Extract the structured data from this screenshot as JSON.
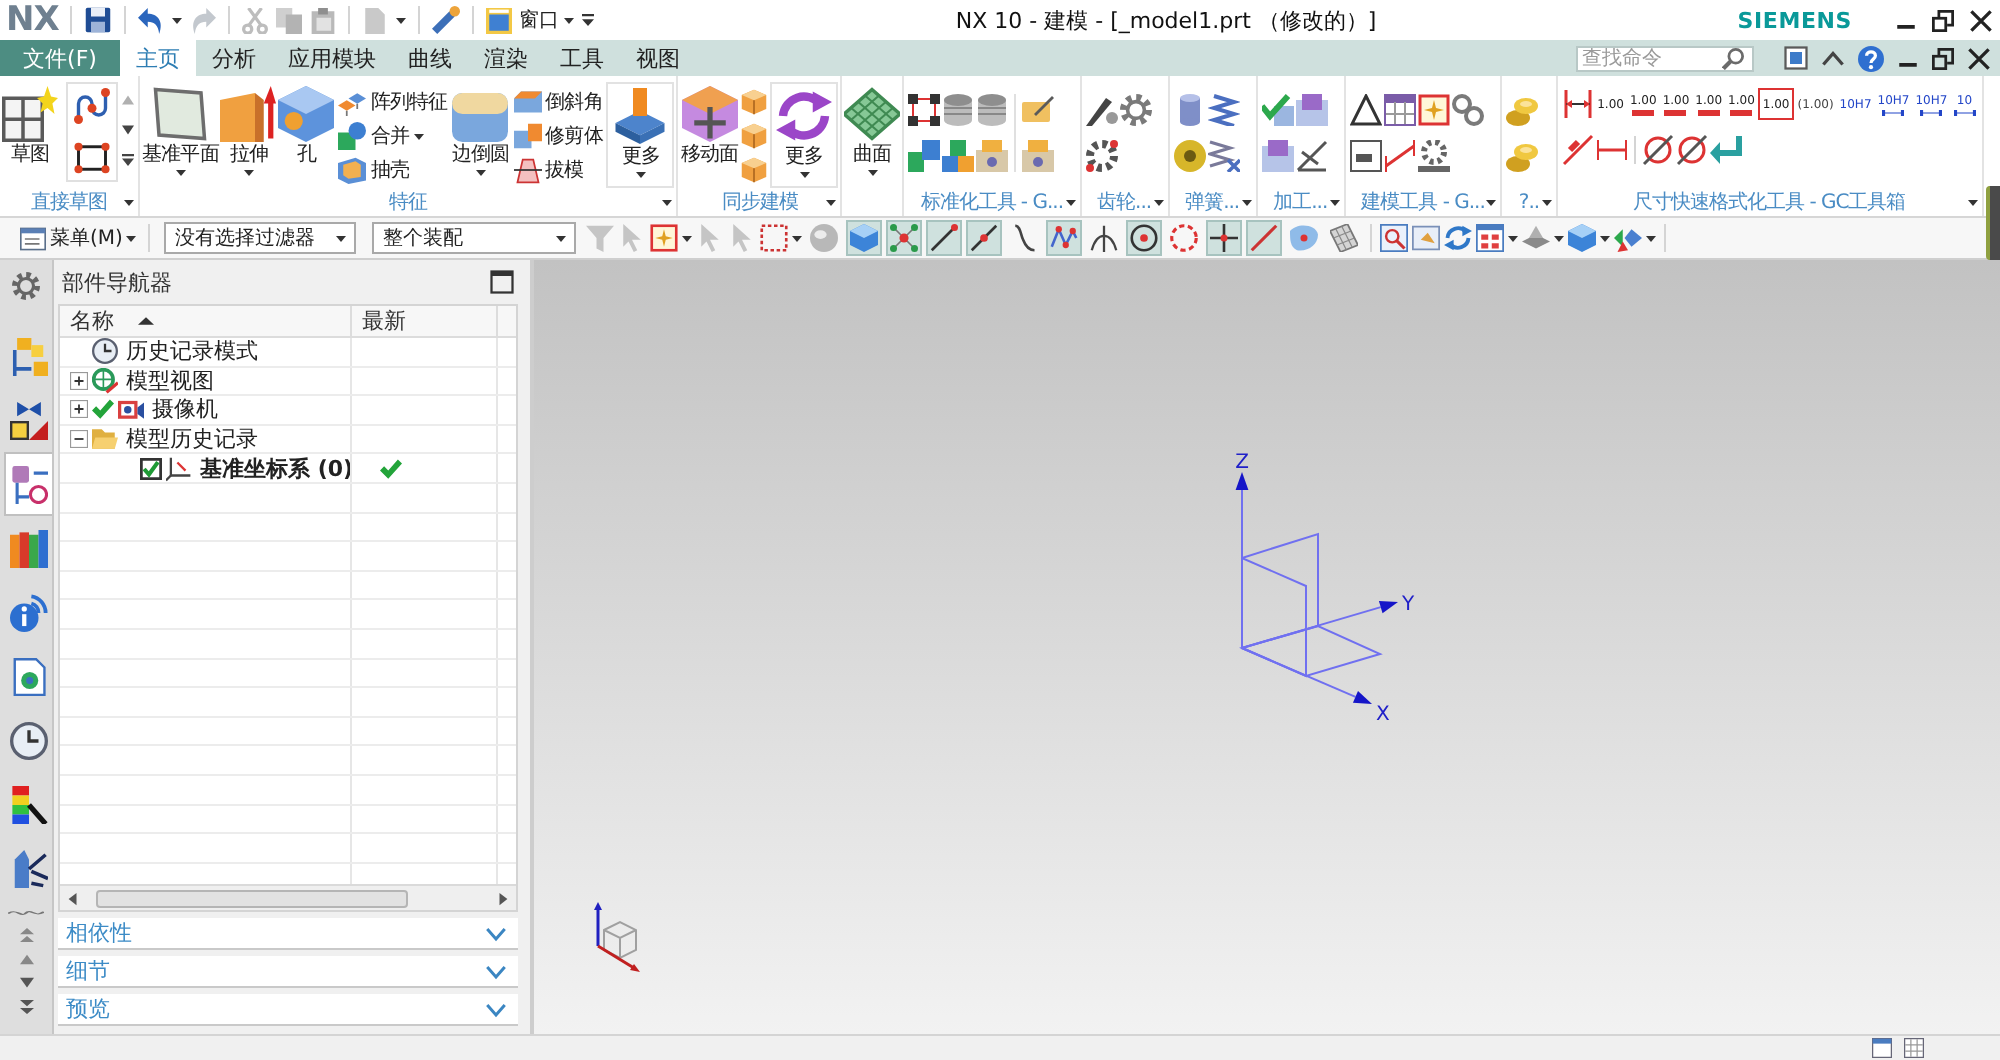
{
  "title_bar": {
    "logo": "NX",
    "window_menu": "窗口",
    "title": "NX 10 - 建模 - [_model1.prt （修改的）]",
    "brand": "SIEMENS"
  },
  "menu_bar": {
    "file_button": "文件(F)",
    "tabs": [
      {
        "label": "主页",
        "selected": true
      },
      {
        "label": "分析",
        "selected": false
      },
      {
        "label": "应用模块",
        "selected": false
      },
      {
        "label": "曲线",
        "selected": false
      },
      {
        "label": "渲染",
        "selected": false
      },
      {
        "label": "工具",
        "selected": false
      },
      {
        "label": "视图",
        "selected": false
      }
    ],
    "search": {
      "placeholder": "查找命令"
    }
  },
  "ribbon": {
    "groups": [
      {
        "label": "直接草图",
        "menu": true,
        "buttons": [
          {
            "kind": "large",
            "label": "草图",
            "dropdown": false
          }
        ]
      },
      {
        "label": "特征",
        "menu": true,
        "buttons": [
          {
            "kind": "large",
            "label": "基准平面",
            "dropdown": true
          },
          {
            "kind": "large",
            "label": "拉伸",
            "dropdown": true
          },
          {
            "kind": "large",
            "label": "孔",
            "dropdown": false
          },
          {
            "kind": "small",
            "label": "阵列特征",
            "dropdown": false
          },
          {
            "kind": "small",
            "label": "合并",
            "dropdown": true
          },
          {
            "kind": "small",
            "label": "抽壳",
            "dropdown": false
          },
          {
            "kind": "large",
            "label": "边倒圆",
            "dropdown": true
          },
          {
            "kind": "small",
            "label": "倒斜角",
            "dropdown": false
          },
          {
            "kind": "small",
            "label": "修剪体",
            "dropdown": false
          },
          {
            "kind": "small",
            "label": "拔模",
            "dropdown": false
          },
          {
            "kind": "menu",
            "label": "更多",
            "dropdown": true
          }
        ]
      },
      {
        "label": "同步建模",
        "menu": true,
        "buttons": [
          {
            "kind": "large",
            "label": "移动面",
            "dropdown": false
          },
          {
            "kind": "menu",
            "label": "更多",
            "dropdown": true
          }
        ]
      },
      {
        "menu": false,
        "buttons": [
          {
            "kind": "large",
            "label": "曲面",
            "dropdown": true
          }
        ]
      },
      {
        "label": "标准化工具 - G...",
        "menu": true
      },
      {
        "label": "齿轮...",
        "menu": true
      },
      {
        "label": "弹簧...",
        "menu": true
      },
      {
        "label": "加工...",
        "menu": true
      },
      {
        "label": "建模工具 - G...",
        "menu": true
      },
      {
        "label": "?..",
        "menu": true
      },
      {
        "label": "尺寸快速格式化工具 - GC工具箱",
        "menu": true,
        "buttons": [
          {
            "kind": "value",
            "label": "1.00"
          },
          {
            "kind": "tolerance",
            "label": "1.00"
          },
          {
            "kind": "tolerance",
            "label": "1.00"
          },
          {
            "kind": "tolerance",
            "label": "1.00"
          },
          {
            "kind": "tolerance",
            "label": "1.00"
          },
          {
            "kind": "basic",
            "label": "1.00"
          },
          {
            "kind": "reference",
            "label": "(1.00)"
          },
          {
            "kind": "fit",
            "label": "10H7"
          },
          {
            "kind": "limits",
            "label": "10H7"
          },
          {
            "kind": "limits",
            "label": "10H7"
          },
          {
            "kind": "limits",
            "label": "10"
          }
        ]
      }
    ]
  },
  "selection_bar": {
    "menu_button": "菜单(M)",
    "type_filter": "没有选择过滤器",
    "scope_filter": "整个装配",
    "snap_toggles": [
      {
        "on": false
      },
      {
        "on": true
      },
      {
        "on": true
      },
      {
        "on": true
      },
      {
        "on": true
      },
      {
        "on": false
      },
      {
        "on": true
      },
      {
        "on": false
      },
      {
        "on": true
      },
      {
        "on": false
      },
      {
        "on": true
      },
      {
        "on": true
      },
      {
        "on": false
      },
      {
        "on": false
      }
    ]
  },
  "resource_bar": {
    "tabs": [
      {
        "selected": false
      },
      {
        "selected": false
      },
      {
        "selected": true
      },
      {
        "selected": false
      },
      {
        "selected": false
      },
      {
        "selected": false
      },
      {
        "selected": false
      },
      {
        "selected": false
      },
      {
        "selected": false
      }
    ]
  },
  "part_navigator": {
    "title": "部件导航器",
    "columns": [
      "名称",
      "最新"
    ],
    "sort_ascending": true,
    "nodes": [
      {
        "label": "历史记录模式",
        "kind": "mode"
      },
      {
        "label": "模型视图",
        "kind": "views",
        "expanded": false
      },
      {
        "label": "摄像机",
        "kind": "cameras",
        "expanded": false,
        "checked": true
      },
      {
        "label": "模型历史记录",
        "kind": "folder",
        "expanded": true,
        "children": [
          {
            "label": "基准坐标系 (0)",
            "kind": "feature",
            "checked": true,
            "latest": true
          }
        ]
      }
    ],
    "panels": [
      {
        "label": "相依性",
        "expanded": false
      },
      {
        "label": "细节",
        "expanded": false
      },
      {
        "label": "预览",
        "expanded": false
      }
    ]
  },
  "graphics_window": {
    "csys_axes": [
      {
        "label": "X"
      },
      {
        "label": "Y"
      },
      {
        "label": "Z"
      }
    ]
  }
}
